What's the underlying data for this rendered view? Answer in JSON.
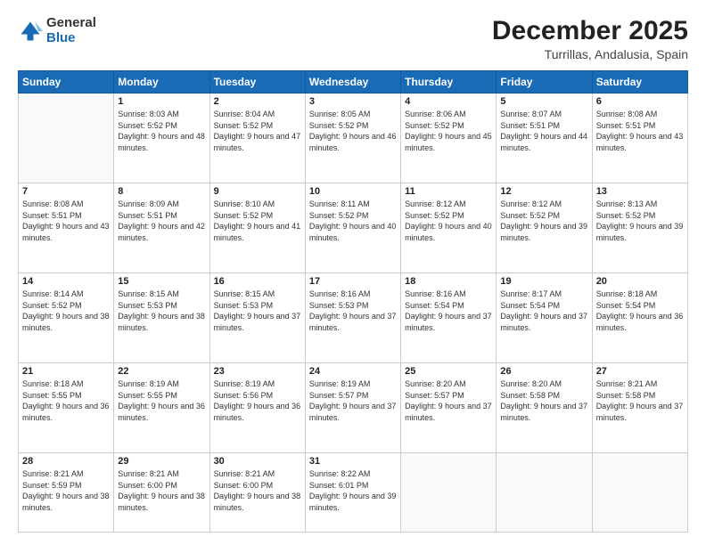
{
  "logo": {
    "general": "General",
    "blue": "Blue"
  },
  "header": {
    "title": "December 2025",
    "subtitle": "Turrillas, Andalusia, Spain"
  },
  "weekdays": [
    "Sunday",
    "Monday",
    "Tuesday",
    "Wednesday",
    "Thursday",
    "Friday",
    "Saturday"
  ],
  "weeks": [
    [
      {
        "num": "",
        "empty": true
      },
      {
        "num": "1",
        "sunrise": "8:03 AM",
        "sunset": "5:52 PM",
        "daylight": "9 hours and 48 minutes."
      },
      {
        "num": "2",
        "sunrise": "8:04 AM",
        "sunset": "5:52 PM",
        "daylight": "9 hours and 47 minutes."
      },
      {
        "num": "3",
        "sunrise": "8:05 AM",
        "sunset": "5:52 PM",
        "daylight": "9 hours and 46 minutes."
      },
      {
        "num": "4",
        "sunrise": "8:06 AM",
        "sunset": "5:52 PM",
        "daylight": "9 hours and 45 minutes."
      },
      {
        "num": "5",
        "sunrise": "8:07 AM",
        "sunset": "5:51 PM",
        "daylight": "9 hours and 44 minutes."
      },
      {
        "num": "6",
        "sunrise": "8:08 AM",
        "sunset": "5:51 PM",
        "daylight": "9 hours and 43 minutes."
      }
    ],
    [
      {
        "num": "7",
        "sunrise": "8:08 AM",
        "sunset": "5:51 PM",
        "daylight": "9 hours and 43 minutes."
      },
      {
        "num": "8",
        "sunrise": "8:09 AM",
        "sunset": "5:51 PM",
        "daylight": "9 hours and 42 minutes."
      },
      {
        "num": "9",
        "sunrise": "8:10 AM",
        "sunset": "5:52 PM",
        "daylight": "9 hours and 41 minutes."
      },
      {
        "num": "10",
        "sunrise": "8:11 AM",
        "sunset": "5:52 PM",
        "daylight": "9 hours and 40 minutes."
      },
      {
        "num": "11",
        "sunrise": "8:12 AM",
        "sunset": "5:52 PM",
        "daylight": "9 hours and 40 minutes."
      },
      {
        "num": "12",
        "sunrise": "8:12 AM",
        "sunset": "5:52 PM",
        "daylight": "9 hours and 39 minutes."
      },
      {
        "num": "13",
        "sunrise": "8:13 AM",
        "sunset": "5:52 PM",
        "daylight": "9 hours and 39 minutes."
      }
    ],
    [
      {
        "num": "14",
        "sunrise": "8:14 AM",
        "sunset": "5:52 PM",
        "daylight": "9 hours and 38 minutes."
      },
      {
        "num": "15",
        "sunrise": "8:15 AM",
        "sunset": "5:53 PM",
        "daylight": "9 hours and 38 minutes."
      },
      {
        "num": "16",
        "sunrise": "8:15 AM",
        "sunset": "5:53 PM",
        "daylight": "9 hours and 37 minutes."
      },
      {
        "num": "17",
        "sunrise": "8:16 AM",
        "sunset": "5:53 PM",
        "daylight": "9 hours and 37 minutes."
      },
      {
        "num": "18",
        "sunrise": "8:16 AM",
        "sunset": "5:54 PM",
        "daylight": "9 hours and 37 minutes."
      },
      {
        "num": "19",
        "sunrise": "8:17 AM",
        "sunset": "5:54 PM",
        "daylight": "9 hours and 37 minutes."
      },
      {
        "num": "20",
        "sunrise": "8:18 AM",
        "sunset": "5:54 PM",
        "daylight": "9 hours and 36 minutes."
      }
    ],
    [
      {
        "num": "21",
        "sunrise": "8:18 AM",
        "sunset": "5:55 PM",
        "daylight": "9 hours and 36 minutes."
      },
      {
        "num": "22",
        "sunrise": "8:19 AM",
        "sunset": "5:55 PM",
        "daylight": "9 hours and 36 minutes."
      },
      {
        "num": "23",
        "sunrise": "8:19 AM",
        "sunset": "5:56 PM",
        "daylight": "9 hours and 36 minutes."
      },
      {
        "num": "24",
        "sunrise": "8:19 AM",
        "sunset": "5:57 PM",
        "daylight": "9 hours and 37 minutes."
      },
      {
        "num": "25",
        "sunrise": "8:20 AM",
        "sunset": "5:57 PM",
        "daylight": "9 hours and 37 minutes."
      },
      {
        "num": "26",
        "sunrise": "8:20 AM",
        "sunset": "5:58 PM",
        "daylight": "9 hours and 37 minutes."
      },
      {
        "num": "27",
        "sunrise": "8:21 AM",
        "sunset": "5:58 PM",
        "daylight": "9 hours and 37 minutes."
      }
    ],
    [
      {
        "num": "28",
        "sunrise": "8:21 AM",
        "sunset": "5:59 PM",
        "daylight": "9 hours and 38 minutes."
      },
      {
        "num": "29",
        "sunrise": "8:21 AM",
        "sunset": "6:00 PM",
        "daylight": "9 hours and 38 minutes."
      },
      {
        "num": "30",
        "sunrise": "8:21 AM",
        "sunset": "6:00 PM",
        "daylight": "9 hours and 38 minutes."
      },
      {
        "num": "31",
        "sunrise": "8:22 AM",
        "sunset": "6:01 PM",
        "daylight": "9 hours and 39 minutes."
      },
      {
        "num": "",
        "empty": true
      },
      {
        "num": "",
        "empty": true
      },
      {
        "num": "",
        "empty": true
      }
    ]
  ]
}
